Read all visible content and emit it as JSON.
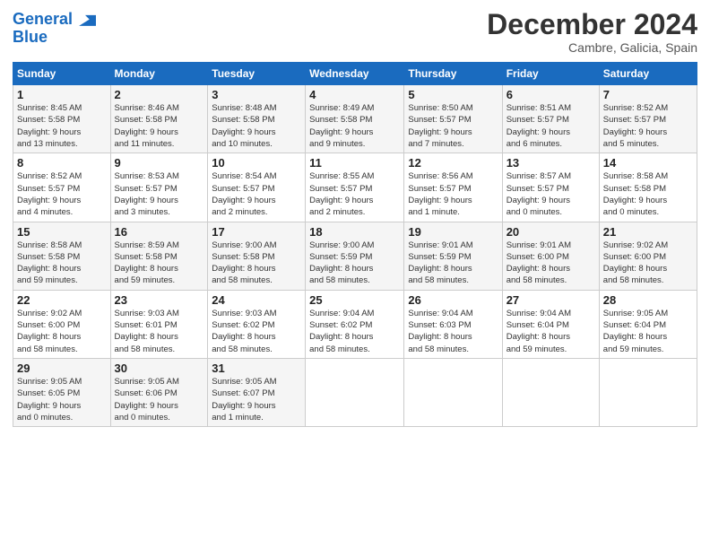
{
  "logo": {
    "line1": "General",
    "line2": "Blue"
  },
  "title": "December 2024",
  "subtitle": "Cambre, Galicia, Spain",
  "headers": [
    "Sunday",
    "Monday",
    "Tuesday",
    "Wednesday",
    "Thursday",
    "Friday",
    "Saturday"
  ],
  "weeks": [
    [
      {
        "day": "1",
        "info": "Sunrise: 8:45 AM\nSunset: 5:58 PM\nDaylight: 9 hours\nand 13 minutes."
      },
      {
        "day": "2",
        "info": "Sunrise: 8:46 AM\nSunset: 5:58 PM\nDaylight: 9 hours\nand 11 minutes."
      },
      {
        "day": "3",
        "info": "Sunrise: 8:48 AM\nSunset: 5:58 PM\nDaylight: 9 hours\nand 10 minutes."
      },
      {
        "day": "4",
        "info": "Sunrise: 8:49 AM\nSunset: 5:58 PM\nDaylight: 9 hours\nand 9 minutes."
      },
      {
        "day": "5",
        "info": "Sunrise: 8:50 AM\nSunset: 5:57 PM\nDaylight: 9 hours\nand 7 minutes."
      },
      {
        "day": "6",
        "info": "Sunrise: 8:51 AM\nSunset: 5:57 PM\nDaylight: 9 hours\nand 6 minutes."
      },
      {
        "day": "7",
        "info": "Sunrise: 8:52 AM\nSunset: 5:57 PM\nDaylight: 9 hours\nand 5 minutes."
      }
    ],
    [
      {
        "day": "8",
        "info": "Sunrise: 8:52 AM\nSunset: 5:57 PM\nDaylight: 9 hours\nand 4 minutes."
      },
      {
        "day": "9",
        "info": "Sunrise: 8:53 AM\nSunset: 5:57 PM\nDaylight: 9 hours\nand 3 minutes."
      },
      {
        "day": "10",
        "info": "Sunrise: 8:54 AM\nSunset: 5:57 PM\nDaylight: 9 hours\nand 2 minutes."
      },
      {
        "day": "11",
        "info": "Sunrise: 8:55 AM\nSunset: 5:57 PM\nDaylight: 9 hours\nand 2 minutes."
      },
      {
        "day": "12",
        "info": "Sunrise: 8:56 AM\nSunset: 5:57 PM\nDaylight: 9 hours\nand 1 minute."
      },
      {
        "day": "13",
        "info": "Sunrise: 8:57 AM\nSunset: 5:57 PM\nDaylight: 9 hours\nand 0 minutes."
      },
      {
        "day": "14",
        "info": "Sunrise: 8:58 AM\nSunset: 5:58 PM\nDaylight: 9 hours\nand 0 minutes."
      }
    ],
    [
      {
        "day": "15",
        "info": "Sunrise: 8:58 AM\nSunset: 5:58 PM\nDaylight: 8 hours\nand 59 minutes."
      },
      {
        "day": "16",
        "info": "Sunrise: 8:59 AM\nSunset: 5:58 PM\nDaylight: 8 hours\nand 59 minutes."
      },
      {
        "day": "17",
        "info": "Sunrise: 9:00 AM\nSunset: 5:58 PM\nDaylight: 8 hours\nand 58 minutes."
      },
      {
        "day": "18",
        "info": "Sunrise: 9:00 AM\nSunset: 5:59 PM\nDaylight: 8 hours\nand 58 minutes."
      },
      {
        "day": "19",
        "info": "Sunrise: 9:01 AM\nSunset: 5:59 PM\nDaylight: 8 hours\nand 58 minutes."
      },
      {
        "day": "20",
        "info": "Sunrise: 9:01 AM\nSunset: 6:00 PM\nDaylight: 8 hours\nand 58 minutes."
      },
      {
        "day": "21",
        "info": "Sunrise: 9:02 AM\nSunset: 6:00 PM\nDaylight: 8 hours\nand 58 minutes."
      }
    ],
    [
      {
        "day": "22",
        "info": "Sunrise: 9:02 AM\nSunset: 6:00 PM\nDaylight: 8 hours\nand 58 minutes."
      },
      {
        "day": "23",
        "info": "Sunrise: 9:03 AM\nSunset: 6:01 PM\nDaylight: 8 hours\nand 58 minutes."
      },
      {
        "day": "24",
        "info": "Sunrise: 9:03 AM\nSunset: 6:02 PM\nDaylight: 8 hours\nand 58 minutes."
      },
      {
        "day": "25",
        "info": "Sunrise: 9:04 AM\nSunset: 6:02 PM\nDaylight: 8 hours\nand 58 minutes."
      },
      {
        "day": "26",
        "info": "Sunrise: 9:04 AM\nSunset: 6:03 PM\nDaylight: 8 hours\nand 58 minutes."
      },
      {
        "day": "27",
        "info": "Sunrise: 9:04 AM\nSunset: 6:04 PM\nDaylight: 8 hours\nand 59 minutes."
      },
      {
        "day": "28",
        "info": "Sunrise: 9:05 AM\nSunset: 6:04 PM\nDaylight: 8 hours\nand 59 minutes."
      }
    ],
    [
      {
        "day": "29",
        "info": "Sunrise: 9:05 AM\nSunset: 6:05 PM\nDaylight: 9 hours\nand 0 minutes."
      },
      {
        "day": "30",
        "info": "Sunrise: 9:05 AM\nSunset: 6:06 PM\nDaylight: 9 hours\nand 0 minutes."
      },
      {
        "day": "31",
        "info": "Sunrise: 9:05 AM\nSunset: 6:07 PM\nDaylight: 9 hours\nand 1 minute."
      },
      null,
      null,
      null,
      null
    ]
  ]
}
